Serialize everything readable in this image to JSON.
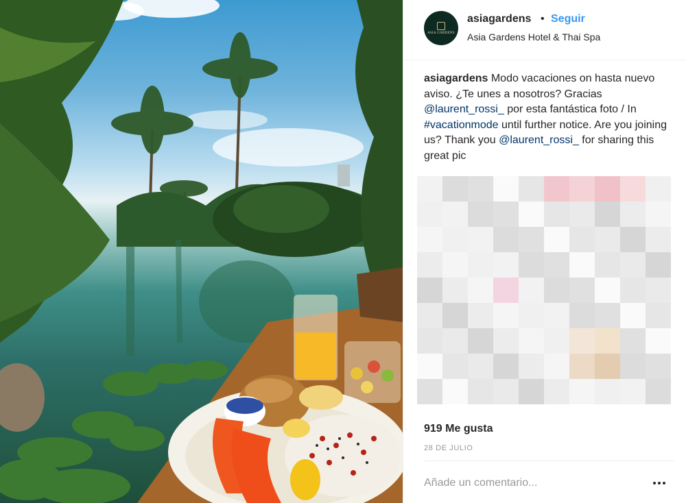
{
  "post": {
    "image_alt": "Tropical infinity pool with breakfast plate",
    "author": {
      "username": "asiagardens",
      "separator": "•",
      "follow_label": "Seguir",
      "location": "Asia Gardens Hotel & Thai Spa",
      "avatar_text": "ASIA GARDENS"
    },
    "caption": {
      "username": "asiagardens",
      "text_1": " Modo vacaciones on hasta nuevo aviso. ¿Te unes a nosotros? Gracias ",
      "mention_1": "@laurent_rossi_",
      "text_2": " por esta fantástica foto / In ",
      "hashtag": "#vacationmode",
      "text_3": " until further notice. Are you joining us? Thank you ",
      "mention_2": "@laurent_rossi_",
      "text_4": " for sharing this great pic"
    },
    "likes": "919 Me gusta",
    "date": "28 DE JULIO",
    "comment_placeholder": "Añade un comentario...",
    "more_icon": "ellipsis-icon"
  }
}
